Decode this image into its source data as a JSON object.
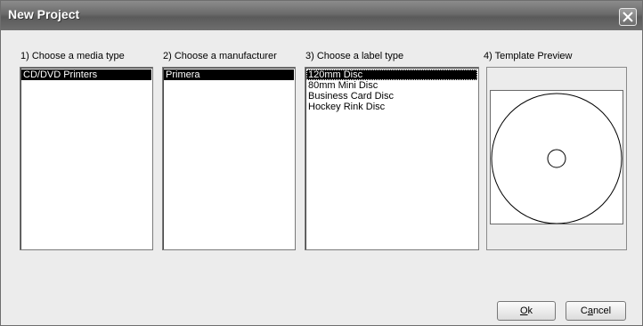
{
  "window": {
    "title": "New Project"
  },
  "columns": [
    {
      "label": "1) Choose a media type",
      "items": [
        "CD/DVD Printers"
      ],
      "selected": 0
    },
    {
      "label": "2) Choose a manufacturer",
      "items": [
        "Primera"
      ],
      "selected": 0
    },
    {
      "label": "3) Choose a label type",
      "items": [
        "120mm Disc",
        "80mm Mini Disc",
        "Business Card Disc",
        "Hockey Rink Disc"
      ],
      "selected": 0
    }
  ],
  "preview": {
    "label": "4) Template Preview"
  },
  "buttons": {
    "ok": {
      "mnemonic": "O",
      "rest": "k"
    },
    "cancel": {
      "pre": "C",
      "mnemonic": "a",
      "rest": "ncel"
    }
  },
  "colors": {
    "titlebar": "#6a6a6a",
    "dialog_bg": "#ececec",
    "selection": "#000000"
  },
  "icons": {
    "close": "close-icon"
  }
}
